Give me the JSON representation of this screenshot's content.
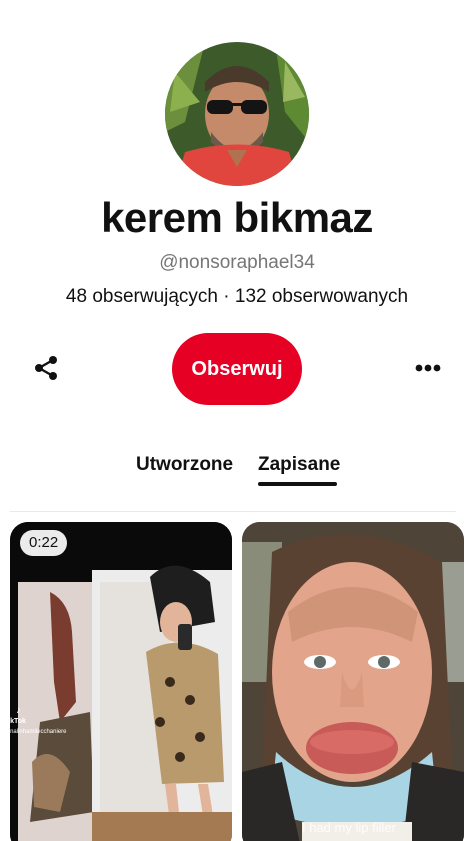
{
  "profile": {
    "name": "kerem bikmaz",
    "handle": "@nonsoraphael34",
    "stats": "48 obserwujących · 132 obserwowanych"
  },
  "actions": {
    "follow_label": "Obserwuj",
    "share_icon": "share-icon",
    "more_icon": "more-icon"
  },
  "tabs": [
    {
      "label": "Utworzone",
      "active": false
    },
    {
      "label": "Zapisane",
      "active": true
    }
  ],
  "pins": [
    {
      "duration": "0:22",
      "watermark_brand": "TikTok",
      "watermark_user": "@nalinhamilecchaniere"
    },
    {
      "caption": "I had my lip filler"
    }
  ],
  "colors": {
    "accent": "#e60023",
    "text": "#111111",
    "muted": "#767676"
  }
}
